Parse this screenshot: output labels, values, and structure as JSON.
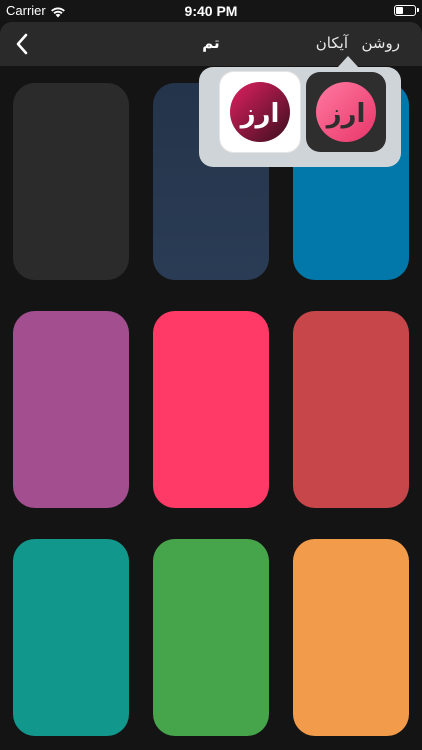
{
  "status_bar": {
    "carrier": "Carrier",
    "time": "9:40 PM",
    "wifi_icon": "wifi-icon",
    "battery_icon": "battery-icon"
  },
  "nav": {
    "back_icon": "chevron-left-icon",
    "title": "تم",
    "action_icon": "آیکان",
    "action_light": "روشن"
  },
  "icon_picker": {
    "options": [
      {
        "name": "dark-app-icon",
        "background": "#2e2e2e",
        "logo_gradient": [
          "#ff7aa0",
          "#e8356a"
        ],
        "logo_text": "ارز"
      },
      {
        "name": "light-app-icon",
        "background": "#ffffff",
        "logo_gradient": [
          "#e02060",
          "#3a0f1e"
        ],
        "logo_text": "ارز"
      }
    ]
  },
  "colors": {
    "background": "#141414",
    "nav_background": "#2a2a2a",
    "popover_background": "#cfd4d8",
    "text": "#ffffff"
  },
  "themes": [
    {
      "name": "charcoal",
      "color": "#2b2b2b"
    },
    {
      "name": "navy-gradient",
      "color_top": "#24344a",
      "color_bottom": "#2a3c55"
    },
    {
      "name": "ocean-blue",
      "color": "#0278aa"
    },
    {
      "name": "plum",
      "color": "#a24e8f"
    },
    {
      "name": "pink",
      "color": "#ff3a67"
    },
    {
      "name": "brick-red",
      "color": "#c64649"
    },
    {
      "name": "teal",
      "color": "#11978b"
    },
    {
      "name": "green",
      "color": "#46a54a"
    },
    {
      "name": "orange",
      "color": "#f29c4b"
    }
  ]
}
